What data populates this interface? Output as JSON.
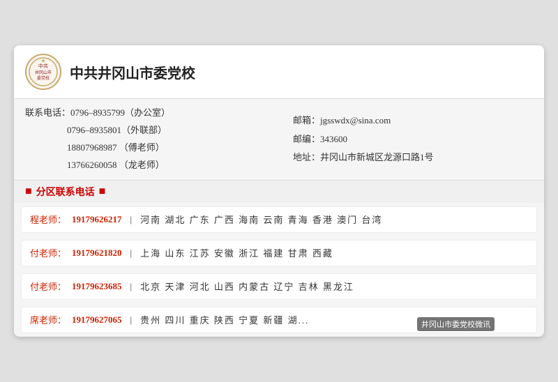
{
  "header": {
    "title": "中共井冈山市委党校",
    "logo_text": "党校"
  },
  "contact": {
    "left": [
      {
        "label": "联系电话：",
        "value": "0796–8935799（办公室）"
      },
      {
        "label": "",
        "value": "0796–8935801（外联部）"
      },
      {
        "label": "",
        "value": "18807968987 （傅老师）"
      },
      {
        "label": "",
        "value": "13766260058 （龙老师）"
      }
    ],
    "right": [
      {
        "label": "邮箱：",
        "value": "jgsswdx@sina.com"
      },
      {
        "label": "邮编：",
        "value": "343600"
      },
      {
        "label": "地址：",
        "value": "井冈山市新城区龙源口路1号"
      }
    ]
  },
  "section_header": "分区联系电话",
  "regions": [
    {
      "teacher": "程老师：",
      "phone": "19179626217",
      "areas": "河南  湖北  广东  广西  海南  云南  青海  香港  澳门  台湾"
    },
    {
      "teacher": "付老师：",
      "phone": "19179621820",
      "areas": "上海  山东  江苏  安徽  浙江  福建  甘肃  西藏"
    },
    {
      "teacher": "付老师：",
      "phone": "19179623685",
      "areas": "北京  天津  河北  山西  内蒙古  辽宁  吉林  黑龙江"
    },
    {
      "teacher": "席老师：",
      "phone": "19179627065",
      "areas": "贵州  四川  重庆  陕西  宁夏  新疆  湖...",
      "has_watermark": true,
      "watermark": "井冈山市委党校微讯"
    }
  ]
}
